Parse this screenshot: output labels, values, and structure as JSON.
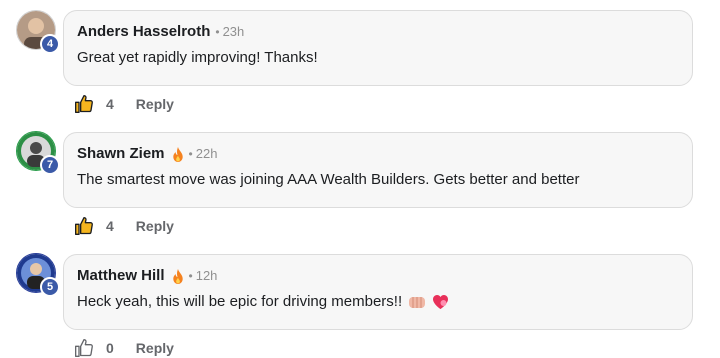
{
  "comments": [
    {
      "author": "Anders Hasselroth",
      "separator": "•",
      "time": "23h",
      "text": "Great yet rapidly improving! Thanks!",
      "level": "4",
      "likes": "4",
      "reply_label": "Reply",
      "flair": ""
    },
    {
      "author": "Shawn Ziem",
      "separator": "•",
      "time": "22h",
      "text": "The smartest move was joining AAA Wealth Builders. Gets better and better",
      "level": "7",
      "likes": "4",
      "reply_label": "Reply",
      "flair": "fire-icon"
    },
    {
      "author": "Matthew Hill",
      "separator": "•",
      "time": "12h",
      "text": "Heck yeah, this will be epic for driving members!!",
      "level": "5",
      "likes": "0",
      "reply_label": "Reply",
      "flair": "fire-icon",
      "emojis": [
        "fist-bump-icon",
        "heart-icon"
      ]
    }
  ],
  "colors": {
    "badge": "#3b5aa8",
    "bubble_bg": "#f7f7f7",
    "action_gray": "#65676b",
    "fire": "#f5821f"
  }
}
